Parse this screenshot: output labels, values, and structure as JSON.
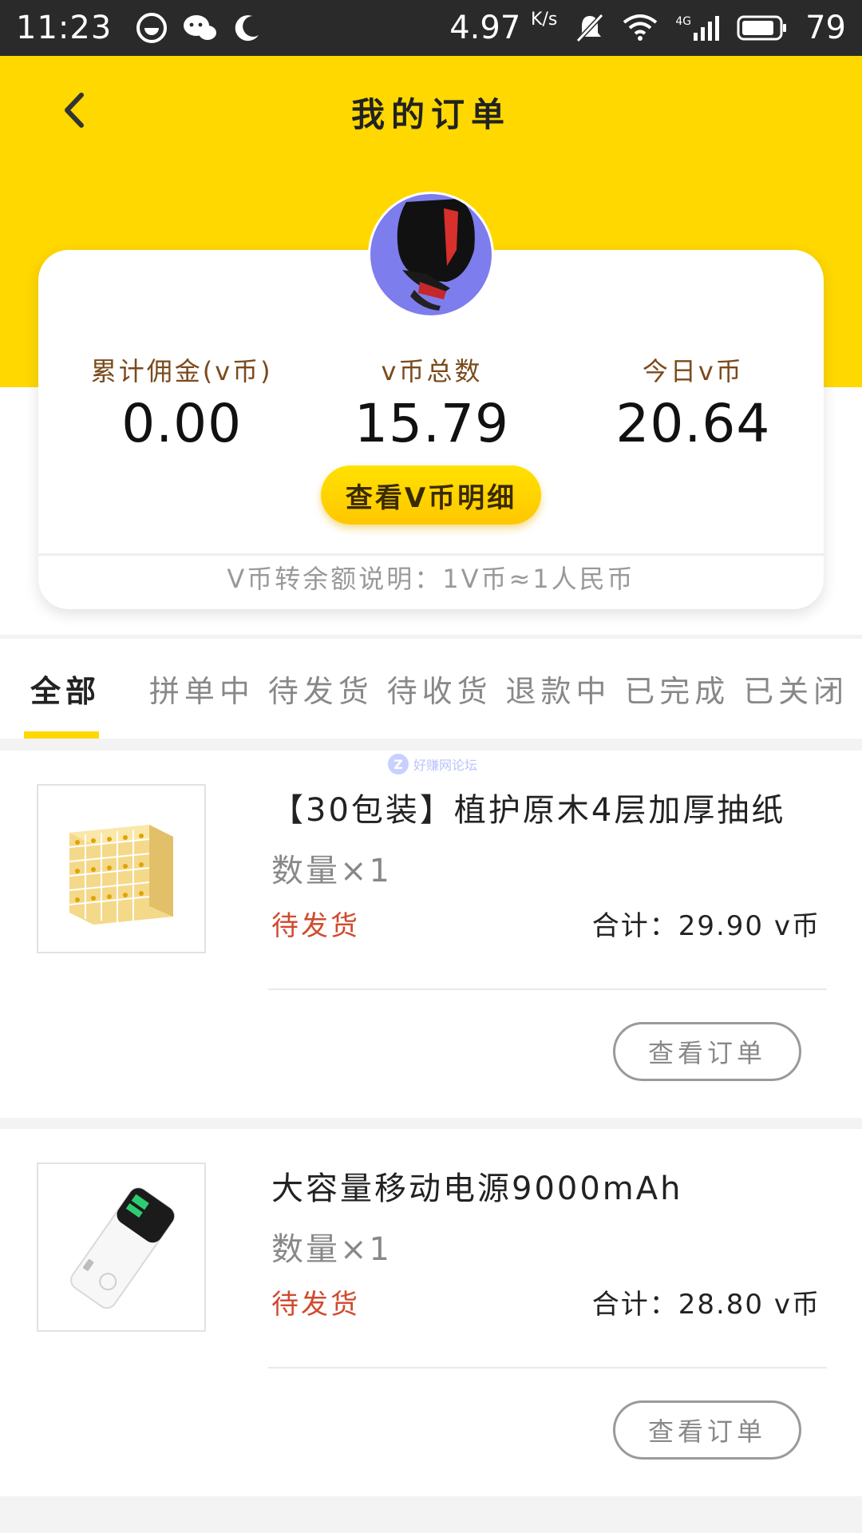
{
  "status_bar": {
    "time": "11:23",
    "speed": "4.97",
    "speed_unit": "K/s",
    "network": "4G",
    "battery": "79",
    "left_icons": [
      "face-app-icon",
      "wechat-icon",
      "moon-icon"
    ]
  },
  "header": {
    "title": "我的订单",
    "back_icon": "chevron-left-icon"
  },
  "summary": {
    "stats": [
      {
        "label": "累计佣金(v币)",
        "value": "0.00"
      },
      {
        "label": "v币总数",
        "value": "15.79"
      },
      {
        "label": "今日v币",
        "value": "20.64"
      }
    ],
    "detail_button": "查看V币明细",
    "note": "V币转余额说明：1V币≈1人民币"
  },
  "tabs": [
    {
      "label": "全部",
      "active": true
    },
    {
      "label": "拼单中",
      "active": false
    },
    {
      "label": "待发货",
      "active": false
    },
    {
      "label": "待收货",
      "active": false
    },
    {
      "label": "退款中",
      "active": false
    },
    {
      "label": "已完成",
      "active": false
    },
    {
      "label": "已关闭",
      "active": false
    }
  ],
  "watermark": {
    "badge": "Z",
    "text": "好赚网论坛"
  },
  "orders": [
    {
      "title": "【30包装】植护原木4层加厚抽纸",
      "quantity": "数量×1",
      "status": "待发货",
      "total": "合计：29.90 v币",
      "button": "查看订单",
      "thumb_icon": "tissue-boxes-icon"
    },
    {
      "title": "大容量移动电源9000mAh",
      "quantity": "数量×1",
      "status": "待发货",
      "total": "合计：28.80 v币",
      "button": "查看订单",
      "thumb_icon": "power-bank-icon"
    }
  ],
  "colors": {
    "accent": "#ffd800",
    "status_red": "#d04a2e",
    "avatar_bg": "#7d7dee"
  }
}
